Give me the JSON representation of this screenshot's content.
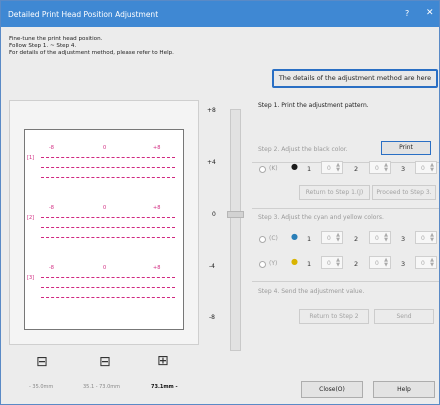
{
  "window": {
    "title": "Detailed Print Head Position Adjustment",
    "help_glyph": "?",
    "close_glyph": "✕"
  },
  "intro": {
    "line1": "Fine-tune the print head position.",
    "line2": "Follow Step 1. ~ Step 4.",
    "line3": "For details of the adjustment method, please refer to Help."
  },
  "details_button": "The details of the adjustment method are here",
  "pattern": {
    "rows": [
      {
        "label": "[1]",
        "nums": [
          "-8",
          "0",
          "+8"
        ]
      },
      {
        "label": "[2]",
        "nums": [
          "-8",
          "0",
          "+8"
        ]
      },
      {
        "label": "[3]",
        "nums": [
          "-8",
          "0",
          "+8"
        ]
      }
    ]
  },
  "scale": {
    "ticks": [
      "+8",
      "+4",
      "0",
      "-4",
      "-8"
    ]
  },
  "media": {
    "items": [
      {
        "label": "- 35.0mm",
        "selected": false
      },
      {
        "label": "35.1 - 73.0mm",
        "selected": false
      },
      {
        "label": "73.1mm -",
        "selected": true
      }
    ]
  },
  "step1": {
    "label": "Step 1. Print the adjustment pattern.",
    "print_button": "Print"
  },
  "step2": {
    "label": "Step 2. Adjust the black color.",
    "option": "(K)",
    "fields": [
      {
        "label": "1",
        "value": "0"
      },
      {
        "label": "2",
        "value": "0"
      },
      {
        "label": "3",
        "value": "0"
      }
    ],
    "return_button": "Return to Step 1.(J)",
    "proceed_button": "Proceed to Step 3."
  },
  "step3": {
    "label": "Step 3. Adjust the cyan and yellow colors.",
    "rows": [
      {
        "option": "(C)",
        "fields": [
          {
            "label": "1",
            "value": "0"
          },
          {
            "label": "2",
            "value": "0"
          },
          {
            "label": "3",
            "value": "0"
          }
        ]
      },
      {
        "option": "(Y)",
        "fields": [
          {
            "label": "1",
            "value": "0"
          },
          {
            "label": "2",
            "value": "0"
          },
          {
            "label": "3",
            "value": "0"
          }
        ]
      }
    ]
  },
  "step4": {
    "label": "Step 4. Send the adjustment value.",
    "return_button": "Return to Step 2",
    "send_button": "Send"
  },
  "footer": {
    "close_button": "Close(O)",
    "help_button": "Help"
  },
  "colors": {
    "accent": "#3f88d3",
    "pattern": "#d0287f",
    "black_ink": "#1a1a1a",
    "cyan_ink": "#2a7fb8",
    "yellow_ink": "#d9b400"
  }
}
